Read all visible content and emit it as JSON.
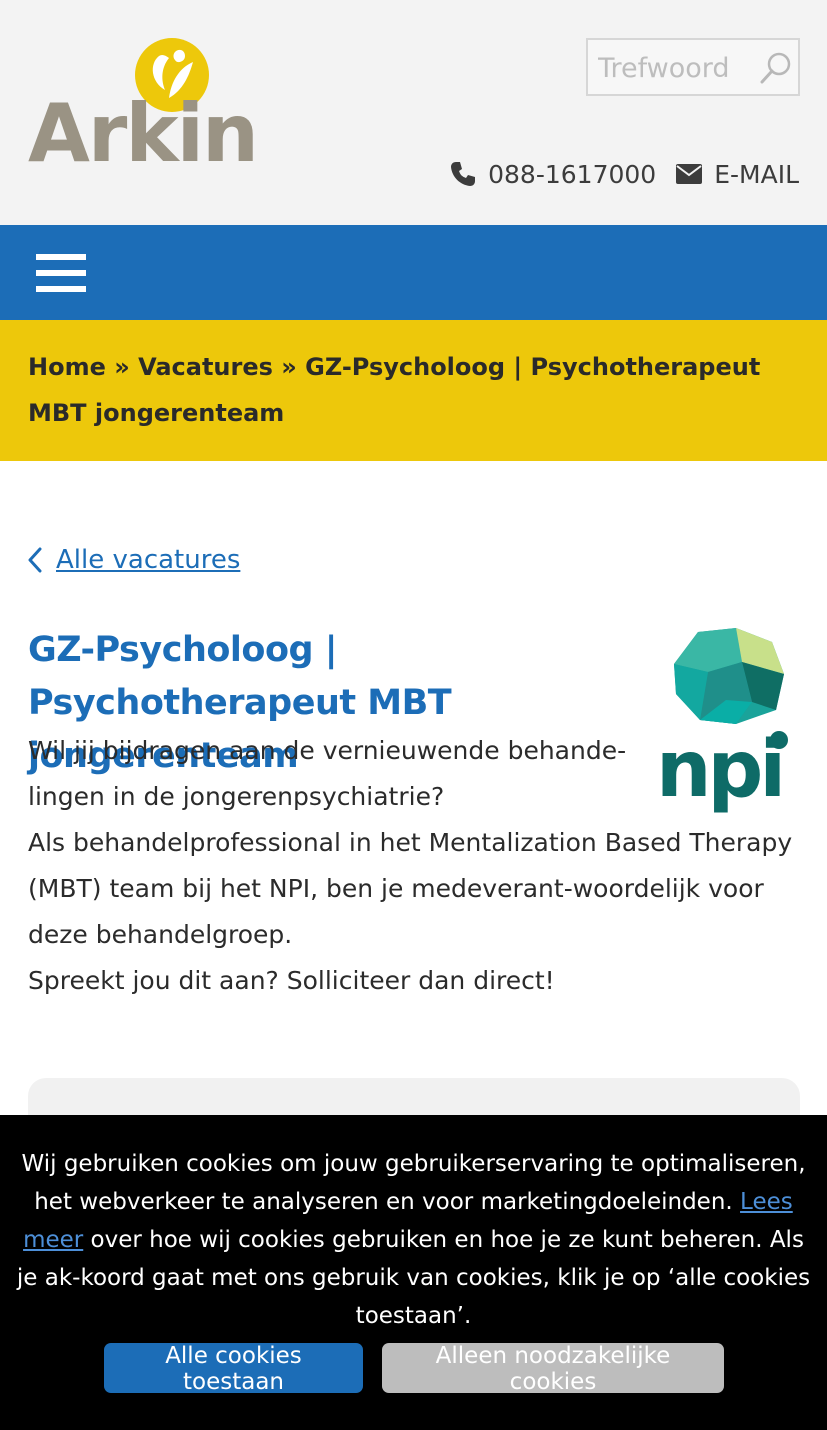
{
  "header": {
    "logo_text": "Arkin",
    "search_placeholder": "Trefwoord",
    "phone": "088-1617000",
    "email_label": "E-MAIL"
  },
  "breadcrumb": {
    "home": "Home",
    "sep1": " » ",
    "vacatures": "Vacatures",
    "sep2": " » ",
    "current": "GZ-Psycholoog | Psychotherapeut MBT jongerenteam"
  },
  "back_link": "Alle vacatures",
  "job": {
    "title": "GZ-Psycholoog | Psychotherapeut MBT jongerenteam",
    "logo_text": "npi",
    "intro_line1": "Wil jij bijdragen aan de vernieuwende behande-lingen in de jongerenpsychiatrie?",
    "intro_line2": "Als behandelprofessional in het Mentalization Based Therapy (MBT) team bij het NPI, ben je medeverant-woordelijk voor deze behandelgroep.",
    "intro_line3": "Spreekt jou dit aan? Solliciteer dan direct!"
  },
  "cookie": {
    "text_before": "Wij gebruiken cookies om jouw gebruikerservaring te optimaliseren, het webverkeer te analyseren en voor marketingdoeleinden. ",
    "link": "Lees meer",
    "text_after": " over hoe wij cookies gebruiken en hoe je ze kunt beheren. Als je ak-koord gaat met ons gebruik van cookies, klik je op ‘alle cookies toestaan’.",
    "accept_label": "Alle cookies toestaan",
    "necessary_label": "Alleen noodzakelijke cookies"
  },
  "colors": {
    "brand_blue": "#1c6db7",
    "brand_yellow": "#edc80b",
    "logo_gray": "#9a9384",
    "npi_teal": "#0e6b67"
  }
}
